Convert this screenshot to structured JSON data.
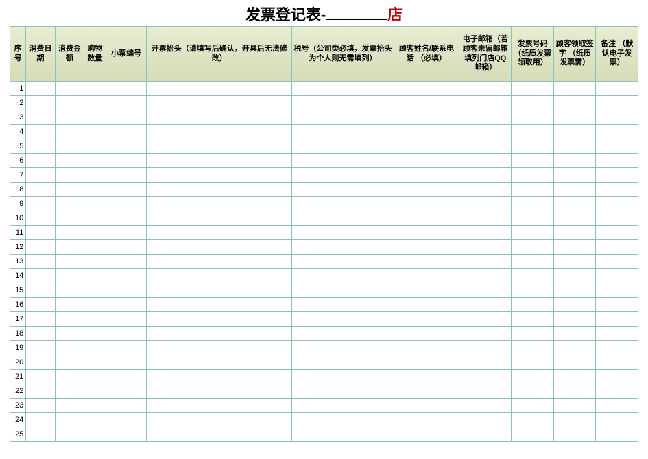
{
  "title": {
    "prefix": "发票登记表-",
    "blank": "",
    "suffix": "店"
  },
  "columns": [
    "序号",
    "消费日期",
    "消费金额",
    "购物数量",
    "小票编号",
    "开票抬头（请填写后确认，开具后无法修改）",
    "税号（公司类必填，发票抬头为个人则无需填列）",
    "顾客姓名/联系电话\n（必填）",
    "电子邮箱（若顾客未留邮箱填列门店QQ邮箱）",
    "发票号码（纸质发票领取用）",
    "顾客领取签字\n（纸质发票需）",
    "备注\n（默认电子发票）"
  ],
  "row_numbers": [
    1,
    2,
    3,
    4,
    5,
    6,
    7,
    8,
    9,
    10,
    11,
    12,
    13,
    14,
    15,
    16,
    17,
    18,
    19,
    20,
    21,
    22,
    23,
    24,
    25
  ]
}
